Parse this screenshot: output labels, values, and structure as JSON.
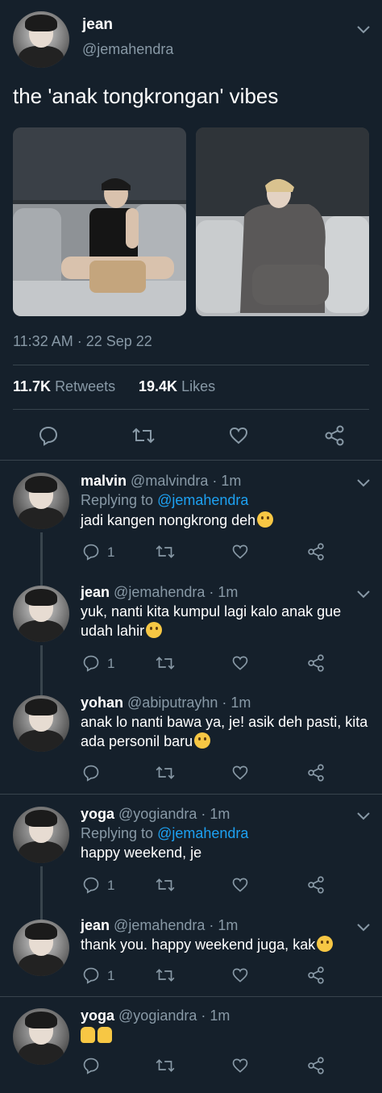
{
  "main_tweet": {
    "name": "jean",
    "handle": "@jemahendra",
    "text": "the 'anak tongkrongan' vibes",
    "time": "11:32 AM · 22 Sep 22",
    "retweets_count": "11.7K",
    "retweets_label": "Retweets",
    "likes_count": "19.4K",
    "likes_label": "Likes"
  },
  "replies": [
    {
      "name": "malvin",
      "handle": "@malvindra",
      "time": "1m",
      "replying_label": "Replying to",
      "replying_to": "@jemahendra",
      "text": "jadi kangen nongkrong deh",
      "reply_count": "1"
    },
    {
      "name": "jean",
      "handle": "@jemahendra",
      "time": "1m",
      "text": "yuk, nanti kita kumpul lagi kalo anak gue udah lahir",
      "reply_count": "1"
    },
    {
      "name": "yohan",
      "handle": "@abiputrayhn",
      "time": "1m",
      "text": "anak lo nanti bawa ya, je! asik deh pasti, kita ada personil baru",
      "reply_count": ""
    },
    {
      "name": "yoga",
      "handle": "@yogiandra",
      "time": "1m",
      "replying_label": "Replying to",
      "replying_to": "@jemahendra",
      "text": "happy weekend, je",
      "reply_count": "1"
    },
    {
      "name": "jean",
      "handle": "@jemahendra",
      "time": "1m",
      "text": "thank you. happy weekend juga, kak",
      "reply_count": "1"
    },
    {
      "name": "yoga",
      "handle": "@yogiandra",
      "time": "1m",
      "text": "",
      "reply_count": ""
    }
  ],
  "separator": "·",
  "colors": {
    "background": "#15202b",
    "link": "#1da1f2",
    "muted": "#8899a6",
    "divider": "#38444d"
  },
  "icons": [
    "chevron-down-icon",
    "reply-icon",
    "retweet-icon",
    "like-icon",
    "share-icon"
  ]
}
